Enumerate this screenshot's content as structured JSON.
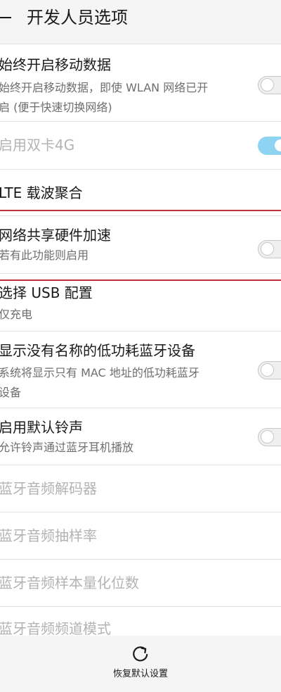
{
  "header": {
    "title": "开发人员选项"
  },
  "rows": [
    {
      "title": "始终开启移动数据",
      "sub1": "始终开启移动数据，即使 WLAN 网络已开",
      "sub2": "启 (便于快速切换网络)",
      "toggle": "off"
    },
    {
      "title": "启用双卡4G",
      "toggle": "on",
      "disabled": true
    },
    {
      "title": "LTE 载波聚合"
    },
    {
      "title": "网络共享硬件加速",
      "sub1": "若有此功能则启用",
      "toggle": "off"
    },
    {
      "title": "选择 USB 配置",
      "sub1": "仅充电"
    },
    {
      "title": "显示没有名称的低功耗蓝牙设备",
      "sub1": "系统将显示只有 MAC 地址的低功耗蓝牙",
      "sub2": "设备",
      "toggle": "off"
    },
    {
      "title": "启用默认铃声",
      "sub1": "允许铃声通过蓝牙耳机播放",
      "toggle": "off"
    },
    {
      "title": "蓝牙音频解码器",
      "disabled": true
    },
    {
      "title": "蓝牙音频抽样率",
      "disabled": true
    },
    {
      "title": "蓝牙音频样本量化位数",
      "disabled": true
    },
    {
      "title": "蓝牙音频频道模式",
      "disabled": true
    }
  ],
  "footer": {
    "reset_label": "恢复默认设置",
    "reset_icon": "refresh-icon"
  },
  "colors": {
    "toggle_on": "#8ed3f2",
    "highlight": "#c0303a"
  }
}
